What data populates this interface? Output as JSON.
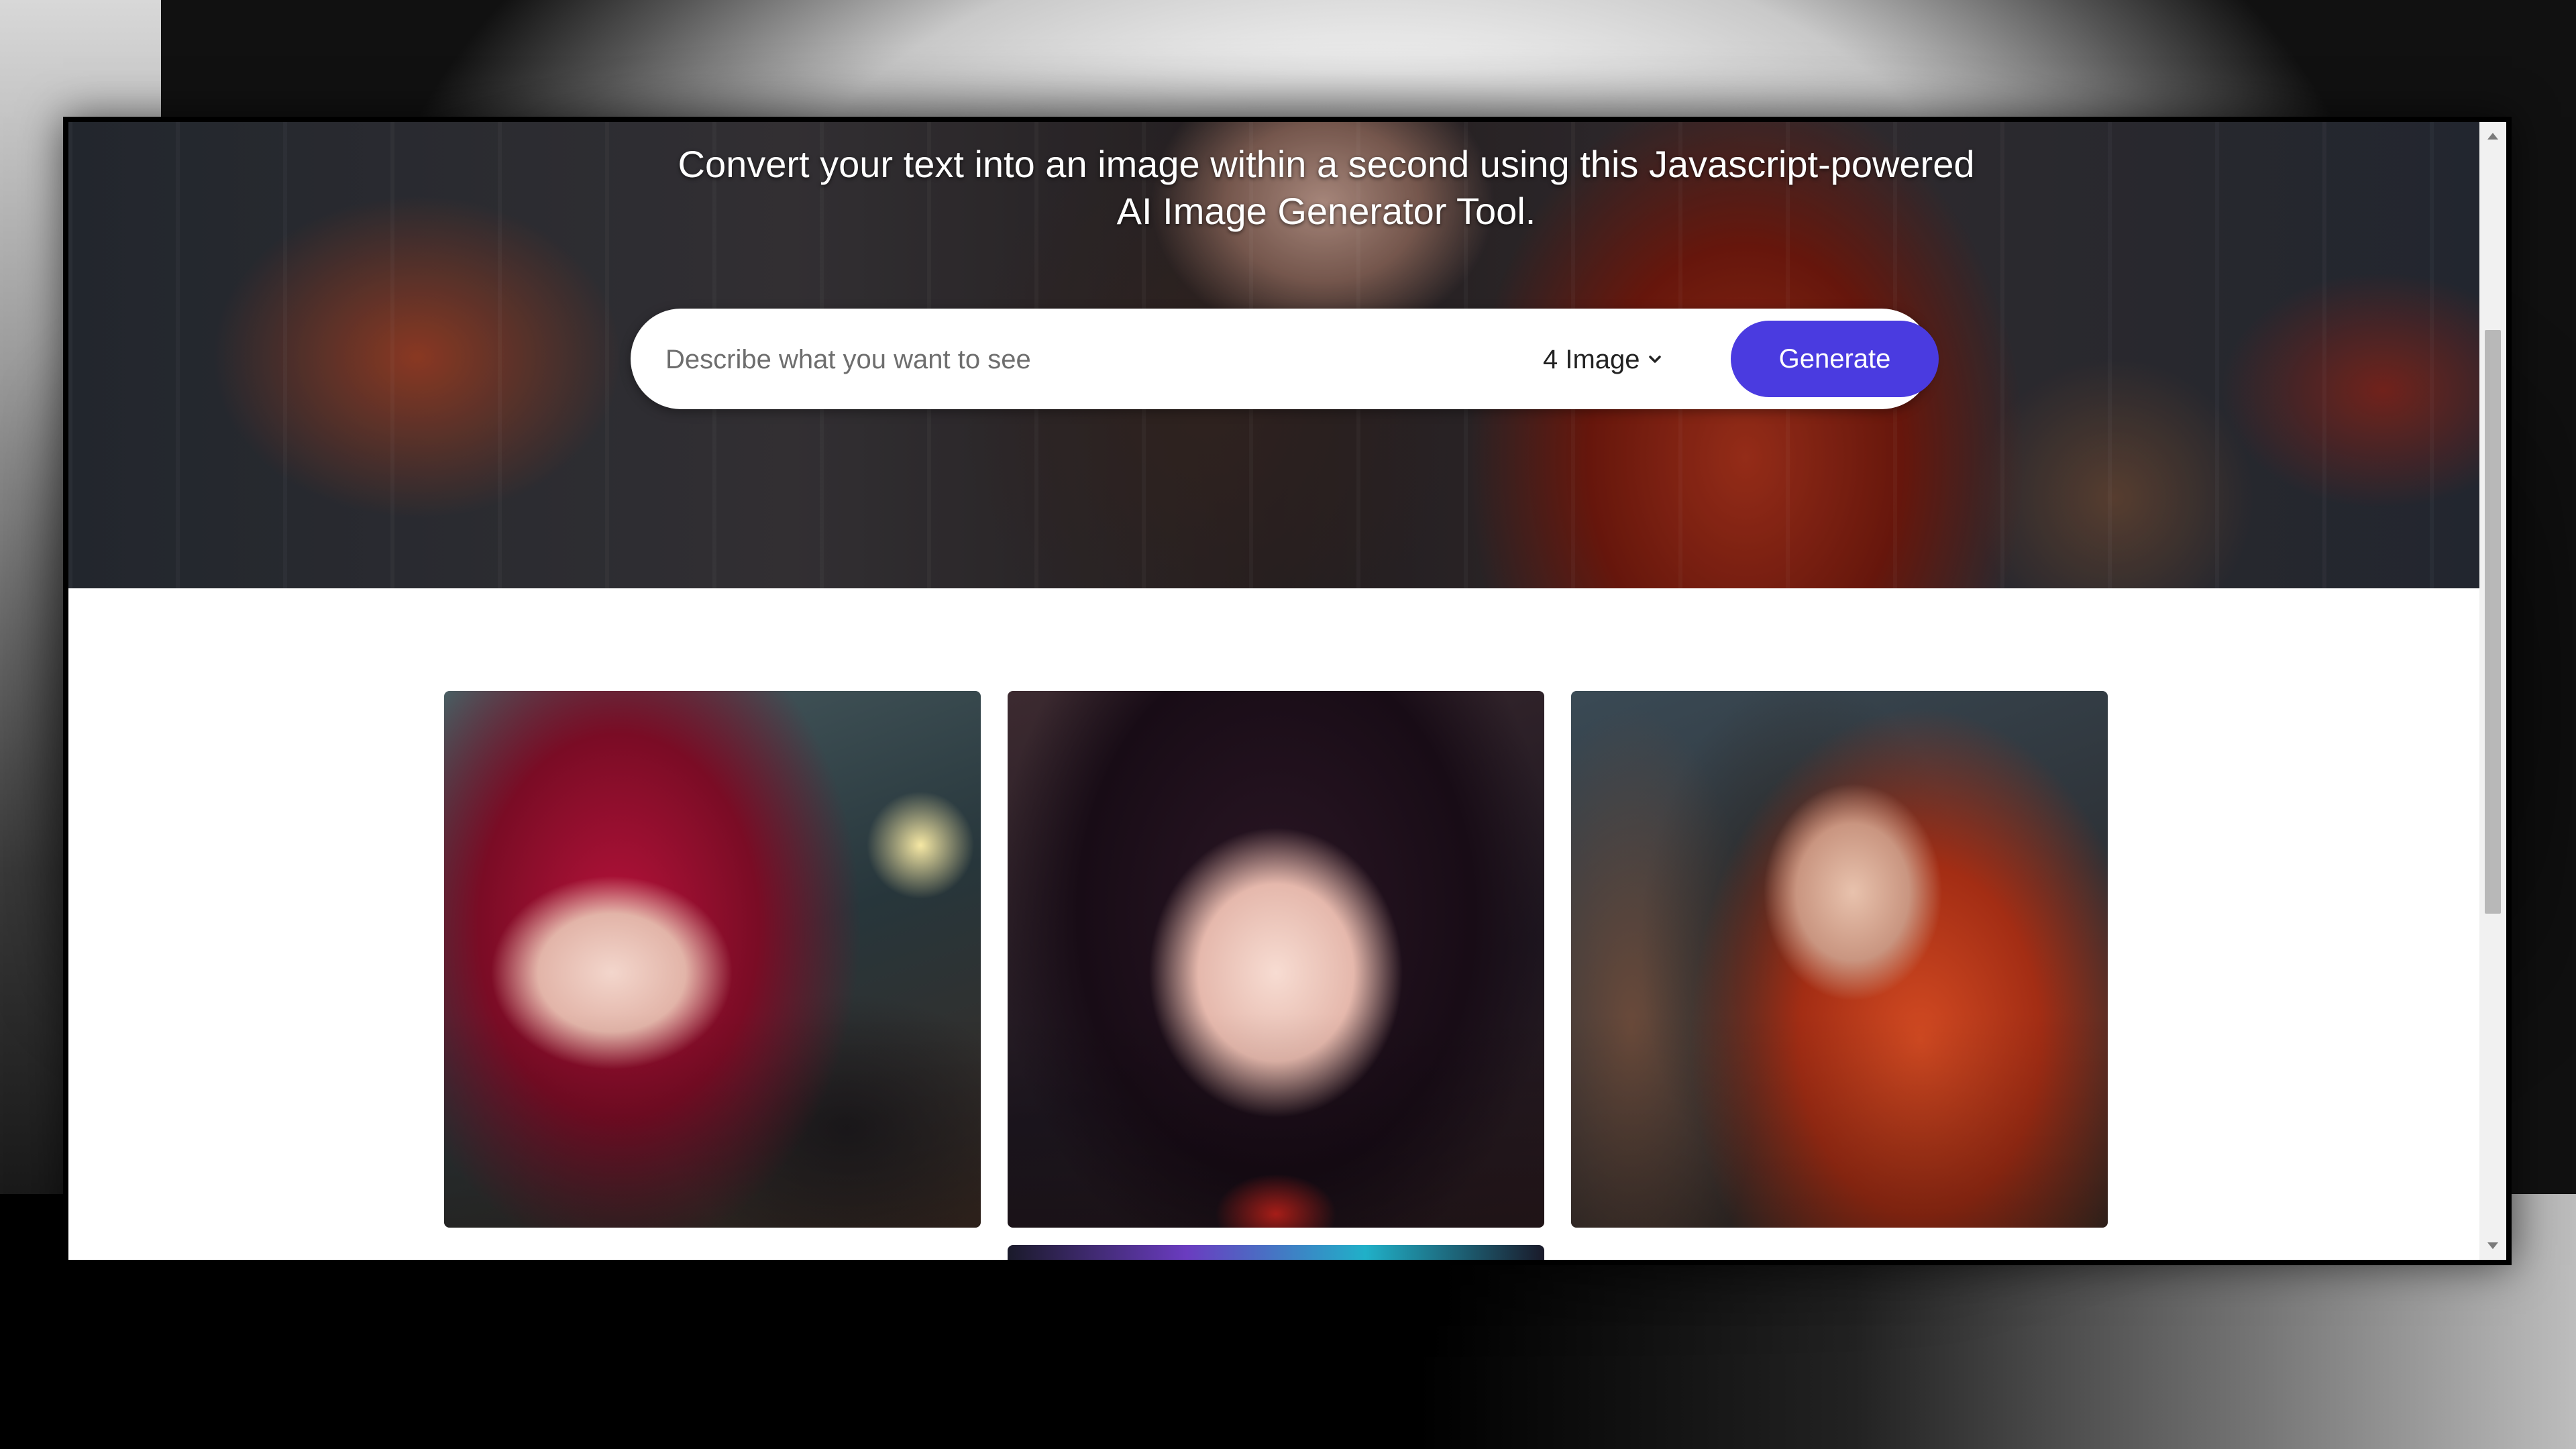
{
  "hero": {
    "title": "Convert your text into an image within a second using this Javascript-powered AI Image Generator Tool."
  },
  "search": {
    "placeholder": "Describe what you want to see",
    "value": ""
  },
  "image_count": {
    "selected": "4 Image",
    "icon": "chevron-down-icon"
  },
  "generate": {
    "label": "Generate",
    "color": "#4a3be0"
  },
  "gallery": {
    "images": [
      {
        "subject": "anime girl with red hair"
      },
      {
        "subject": "anime girl with dark hair and horns"
      },
      {
        "subject": "anime girl in red hooded jacket"
      }
    ]
  },
  "colors": {
    "accent": "#4a3be0",
    "hero_text": "#ffffff",
    "page_background": "#ffffff"
  }
}
